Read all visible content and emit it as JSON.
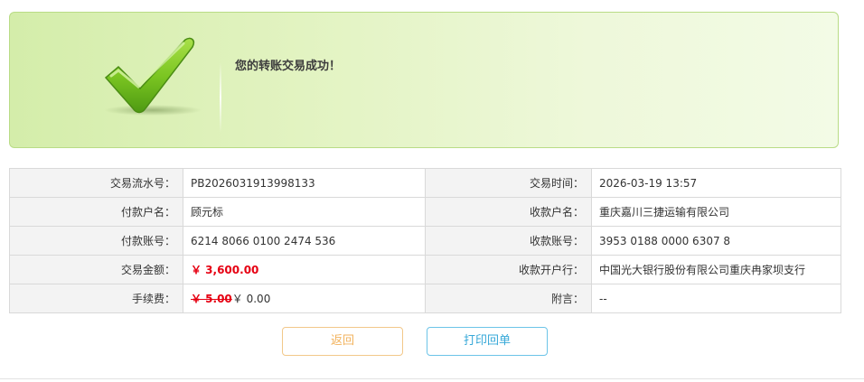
{
  "banner": {
    "message": "您的转账交易成功！",
    "icon": "check-icon",
    "accent_color": "#7cc622"
  },
  "details": {
    "rows": [
      {
        "l1": "交易流水号：",
        "v1": "PB2026031913998133",
        "l2": "交易时间：",
        "v2": "2026-03-19 13:57"
      },
      {
        "l1": "付款户名：",
        "v1": "顾元标",
        "l2": "收款户名：",
        "v2": "重庆嘉川三捷运输有限公司"
      },
      {
        "l1": "付款账号：",
        "v1": "6214 8066 0100 2474 536",
        "l2": "收款账号：",
        "v2": "3953 0188 0000 6307 8"
      },
      {
        "l1": "交易金额：",
        "v1": "￥ 3,600.00",
        "l2": "收款开户行：",
        "v2": "中国光大银行股份有限公司重庆冉家坝支行"
      },
      {
        "l1": "手续费：",
        "fee_original": "￥ 5.00",
        "fee_actual": "￥ 0.00",
        "l2": "附言：",
        "v2": "--"
      }
    ]
  },
  "actions": {
    "back_label": "返回",
    "print_label": "打印回单"
  },
  "colors": {
    "amount": "#e60012",
    "back_border": "#f2c88a",
    "print_border": "#6cc4e8"
  }
}
